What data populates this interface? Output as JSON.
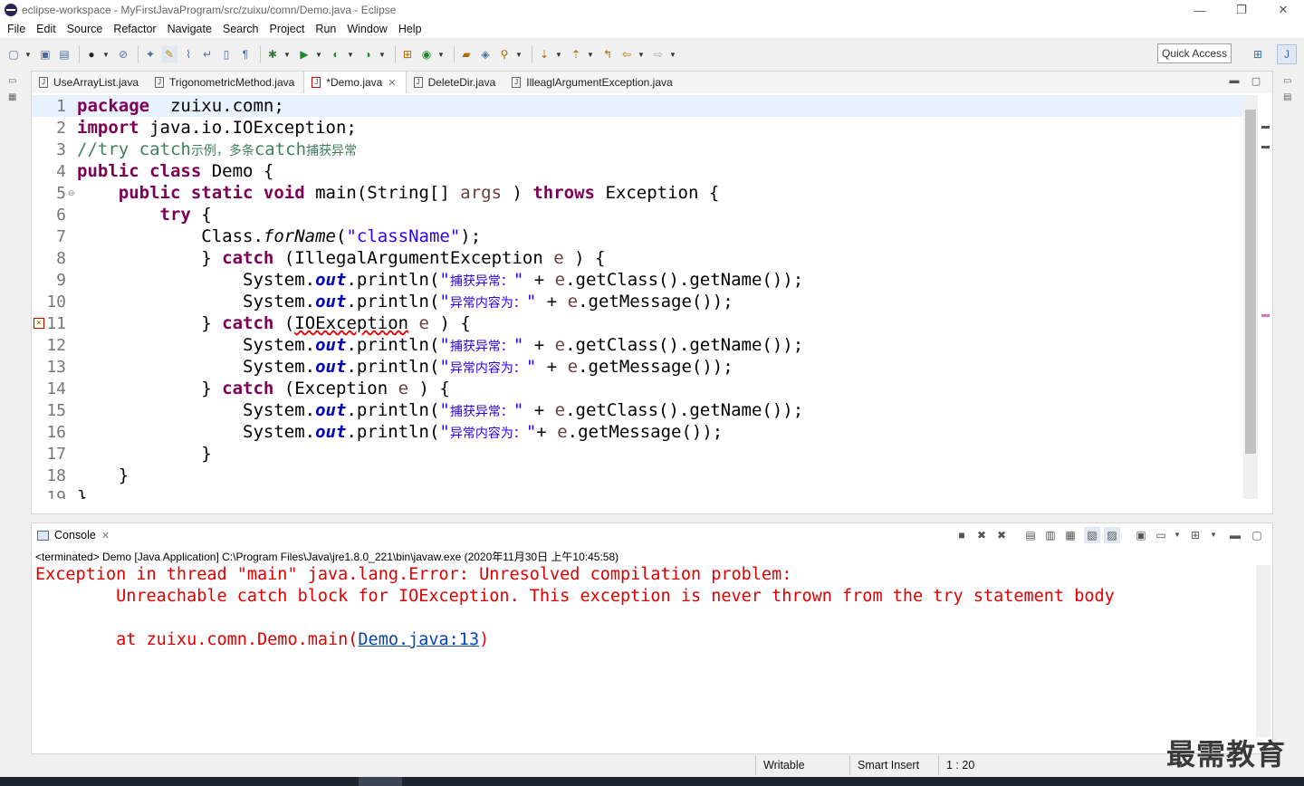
{
  "window": {
    "title": "eclipse-workspace - MyFirstJavaProgram/src/zuixu/comn/Demo.java - Eclipse",
    "minimize": "—",
    "restore": "❐",
    "close": "✕"
  },
  "menu": [
    "File",
    "Edit",
    "Source",
    "Refactor",
    "Navigate",
    "Search",
    "Project",
    "Run",
    "Window",
    "Help"
  ],
  "toolbar": {
    "quick_access": "Quick Access"
  },
  "editor": {
    "tabs": [
      {
        "label": "UseArrayList.java",
        "active": false
      },
      {
        "label": "TrigonometricMethod.java",
        "active": false
      },
      {
        "label": "*Demo.java",
        "active": true
      },
      {
        "label": "DeleteDir.java",
        "active": false
      },
      {
        "label": "IlleaglArgumentException.java",
        "active": false
      }
    ],
    "current_line": 1,
    "error_line": 11,
    "fold_line": 5,
    "lines": [
      {
        "no": "1",
        "tokens": [
          [
            "kw",
            "package"
          ],
          [
            "",
            "  zuixu.comn;"
          ]
        ]
      },
      {
        "no": "2",
        "tokens": [
          [
            "kw",
            "import"
          ],
          [
            "",
            " java.io.IOException;"
          ]
        ]
      },
      {
        "no": "3",
        "tokens": [
          [
            "cm",
            "//try catch"
          ],
          [
            "cm cjk",
            "示例，多条"
          ],
          [
            "cm",
            "catch"
          ],
          [
            "cm cjk",
            "捕获异常"
          ]
        ]
      },
      {
        "no": "4",
        "tokens": [
          [
            "kw",
            "public class"
          ],
          [
            "",
            " Demo {"
          ]
        ]
      },
      {
        "no": "5",
        "tokens": [
          [
            "",
            "    "
          ],
          [
            "kw",
            "public static void"
          ],
          [
            "",
            " main(String[] "
          ],
          [
            "var",
            "args"
          ],
          [
            "",
            " ) "
          ],
          [
            "kw",
            "throws"
          ],
          [
            "",
            " Exception {"
          ]
        ]
      },
      {
        "no": "6",
        "tokens": [
          [
            "",
            "        "
          ],
          [
            "kw",
            "try"
          ],
          [
            "",
            " {"
          ]
        ]
      },
      {
        "no": "7",
        "tokens": [
          [
            "",
            "            Class."
          ],
          [
            "it",
            "forName"
          ],
          [
            "",
            "("
          ],
          [
            "str",
            "\"className\""
          ],
          [
            "",
            ");"
          ]
        ]
      },
      {
        "no": "8",
        "tokens": [
          [
            "",
            "            } "
          ],
          [
            "kw",
            "catch"
          ],
          [
            "",
            " (IllegalArgumentException "
          ],
          [
            "var",
            "e"
          ],
          [
            "",
            " ) {"
          ]
        ]
      },
      {
        "no": "9",
        "tokens": [
          [
            "",
            "                System."
          ],
          [
            "fld",
            "out"
          ],
          [
            "",
            ".println("
          ],
          [
            "str",
            "\""
          ],
          [
            "str cjk",
            "捕获异常："
          ],
          [
            "str",
            "\""
          ],
          [
            "",
            " + "
          ],
          [
            "var",
            "e"
          ],
          [
            "",
            ".getClass().getName());"
          ]
        ]
      },
      {
        "no": "10",
        "tokens": [
          [
            "",
            "                System."
          ],
          [
            "fld",
            "out"
          ],
          [
            "",
            ".println("
          ],
          [
            "str",
            "\""
          ],
          [
            "str cjk",
            "异常内容为："
          ],
          [
            "str",
            "\""
          ],
          [
            "",
            " + "
          ],
          [
            "var",
            "e"
          ],
          [
            "",
            ".getMessage());"
          ]
        ]
      },
      {
        "no": "11",
        "tokens": [
          [
            "",
            "            } "
          ],
          [
            "kw",
            "catch"
          ],
          [
            "",
            " ("
          ],
          [
            "err",
            "IOException"
          ],
          [
            "",
            " "
          ],
          [
            "var",
            "e"
          ],
          [
            "",
            " ) {"
          ]
        ]
      },
      {
        "no": "12",
        "tokens": [
          [
            "",
            "                System."
          ],
          [
            "fld",
            "out"
          ],
          [
            "",
            ".println("
          ],
          [
            "str",
            "\""
          ],
          [
            "str cjk",
            "捕获异常："
          ],
          [
            "str",
            "\""
          ],
          [
            "",
            " + "
          ],
          [
            "var",
            "e"
          ],
          [
            "",
            ".getClass().getName());"
          ]
        ]
      },
      {
        "no": "13",
        "tokens": [
          [
            "",
            "                System."
          ],
          [
            "fld",
            "out"
          ],
          [
            "",
            ".println("
          ],
          [
            "str",
            "\""
          ],
          [
            "str cjk",
            "异常内容为："
          ],
          [
            "str",
            "\""
          ],
          [
            "",
            " + "
          ],
          [
            "var",
            "e"
          ],
          [
            "",
            ".getMessage());"
          ]
        ]
      },
      {
        "no": "14",
        "tokens": [
          [
            "",
            "            } "
          ],
          [
            "kw",
            "catch"
          ],
          [
            "",
            " (Exception "
          ],
          [
            "var",
            "e"
          ],
          [
            "",
            " ) {"
          ]
        ]
      },
      {
        "no": "15",
        "tokens": [
          [
            "",
            "                System."
          ],
          [
            "fld",
            "out"
          ],
          [
            "",
            ".println("
          ],
          [
            "str",
            "\""
          ],
          [
            "str cjk",
            "捕获异常："
          ],
          [
            "str",
            "\""
          ],
          [
            "",
            " + "
          ],
          [
            "var",
            "e"
          ],
          [
            "",
            ".getClass().getName());"
          ]
        ]
      },
      {
        "no": "16",
        "tokens": [
          [
            "",
            "                System."
          ],
          [
            "fld",
            "out"
          ],
          [
            "",
            ".println("
          ],
          [
            "str",
            "\""
          ],
          [
            "str cjk",
            "异常内容为："
          ],
          [
            "str",
            "\""
          ],
          [
            "",
            "+ "
          ],
          [
            "var",
            "e"
          ],
          [
            "",
            ".getMessage());"
          ]
        ]
      },
      {
        "no": "17",
        "tokens": [
          [
            "",
            "            }"
          ]
        ]
      },
      {
        "no": "18",
        "tokens": [
          [
            "",
            "    }"
          ]
        ]
      },
      {
        "no": "19",
        "tokens": [
          [
            "",
            "}"
          ]
        ]
      }
    ]
  },
  "console": {
    "tab_label": "Console",
    "status": "<terminated> Demo [Java Application] C:\\Program Files\\Java\\jre1.8.0_221\\bin\\javaw.exe (2020年11月30日 上午10:45:58)",
    "output": {
      "line1": "Exception in thread \"main\" java.lang.Error: Unresolved compilation problem: ",
      "line2": "        Unreachable catch block for IOException. This exception is never thrown from the try statement body",
      "line3_prefix": "        at zuixu.comn.Demo.main(",
      "line3_link": "Demo.java:13",
      "line3_suffix": ")"
    }
  },
  "statusbar": {
    "writable": "Writable",
    "insert_mode": "Smart Insert",
    "position": "1 : 20"
  },
  "watermark": "最需教育",
  "colors": {
    "keyword": "#7f0055",
    "comment": "#3f7f5f",
    "string": "#2a00ff",
    "field": "#0000c0",
    "console_error": "#e00000",
    "current_line": "#e8f2fe"
  }
}
